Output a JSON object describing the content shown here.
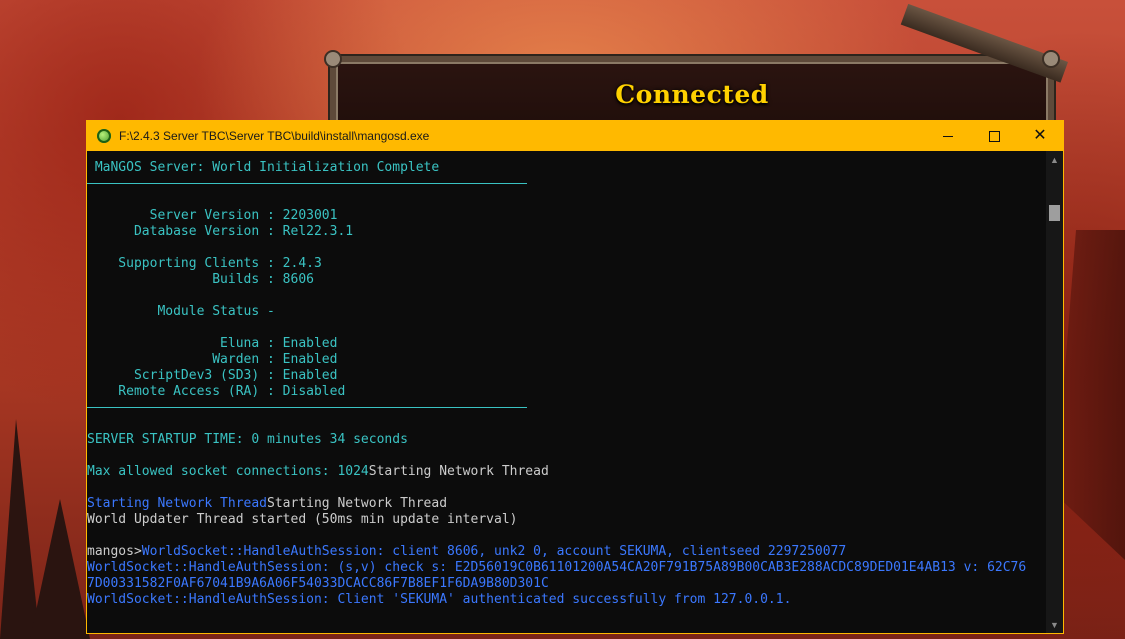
{
  "background": {
    "game_title": "Connected"
  },
  "window": {
    "title": "F:\\2.4.3 Server TBC\\Server TBC\\build\\install\\mangosd.exe",
    "accent_color": "#ffb900",
    "controls": {
      "minimize": "minimize",
      "maximize": "maximize",
      "close": "✕"
    }
  },
  "console": {
    "lines": [
      {
        "text": " MaNGOS Server: World Initialization Complete",
        "color": "cyan"
      },
      {
        "text": "",
        "color": "sep"
      },
      {
        "text": "",
        "color": "cyan"
      },
      {
        "text": "        Server Version : 2203001",
        "color": "cyan"
      },
      {
        "text": "      Database Version : Rel22.3.1",
        "color": "cyan"
      },
      {
        "text": "",
        "color": "cyan"
      },
      {
        "text": "    Supporting Clients : 2.4.3",
        "color": "cyan"
      },
      {
        "text": "                Builds : 8606",
        "color": "cyan"
      },
      {
        "text": "",
        "color": "cyan"
      },
      {
        "text": "         Module Status -",
        "color": "cyan"
      },
      {
        "text": "",
        "color": "cyan"
      },
      {
        "text": "                 Eluna : Enabled",
        "color": "cyan"
      },
      {
        "text": "                Warden : Enabled",
        "color": "cyan"
      },
      {
        "text": "      ScriptDev3 (SD3) : Enabled",
        "color": "cyan"
      },
      {
        "text": "    Remote Access (RA) : Disabled",
        "color": "cyan"
      },
      {
        "text": "",
        "color": "sep"
      },
      {
        "text": "",
        "color": "cyan"
      },
      {
        "text": "SERVER STARTUP TIME: 0 minutes 34 seconds",
        "color": "cyan"
      },
      {
        "text": "",
        "color": "cyan"
      },
      {
        "segments": [
          {
            "text": "Max allowed socket connections: 1024",
            "color": "cyan"
          },
          {
            "text": "Starting Network Thread",
            "color": "white"
          }
        ]
      },
      {
        "text": "",
        "color": "cyan"
      },
      {
        "segments": [
          {
            "text": "Starting Network Thread",
            "color": "blue"
          },
          {
            "text": "Starting Network Thread",
            "color": "white"
          }
        ]
      },
      {
        "text": "World Updater Thread started (50ms min update interval)",
        "color": "white"
      },
      {
        "text": "",
        "color": "white"
      },
      {
        "segments": [
          {
            "text": "mangos>",
            "color": "white"
          },
          {
            "text": "WorldSocket::HandleAuthSession: client 8606, unk2 0, account SEKUMA, clientseed 2297250077",
            "color": "blue"
          }
        ]
      },
      {
        "text": "WorldSocket::HandleAuthSession: (s,v) check s: E2D56019C0B61101200A54CA20F791B75A89B00CAB3E288ACDC89DED01E4AB13 v: 62C76",
        "color": "blue"
      },
      {
        "text": "7D00331582F0AF67041B9A6A06F54033DCACC86F7B8EF1F6DA9B80D301C",
        "color": "blue"
      },
      {
        "text": "WorldSocket::HandleAuthSession: Client 'SEKUMA' authenticated successfully from 127.0.0.1.",
        "color": "blue"
      }
    ]
  },
  "scrollbar": {
    "up_arrow": "▲",
    "down_arrow": "▼"
  }
}
